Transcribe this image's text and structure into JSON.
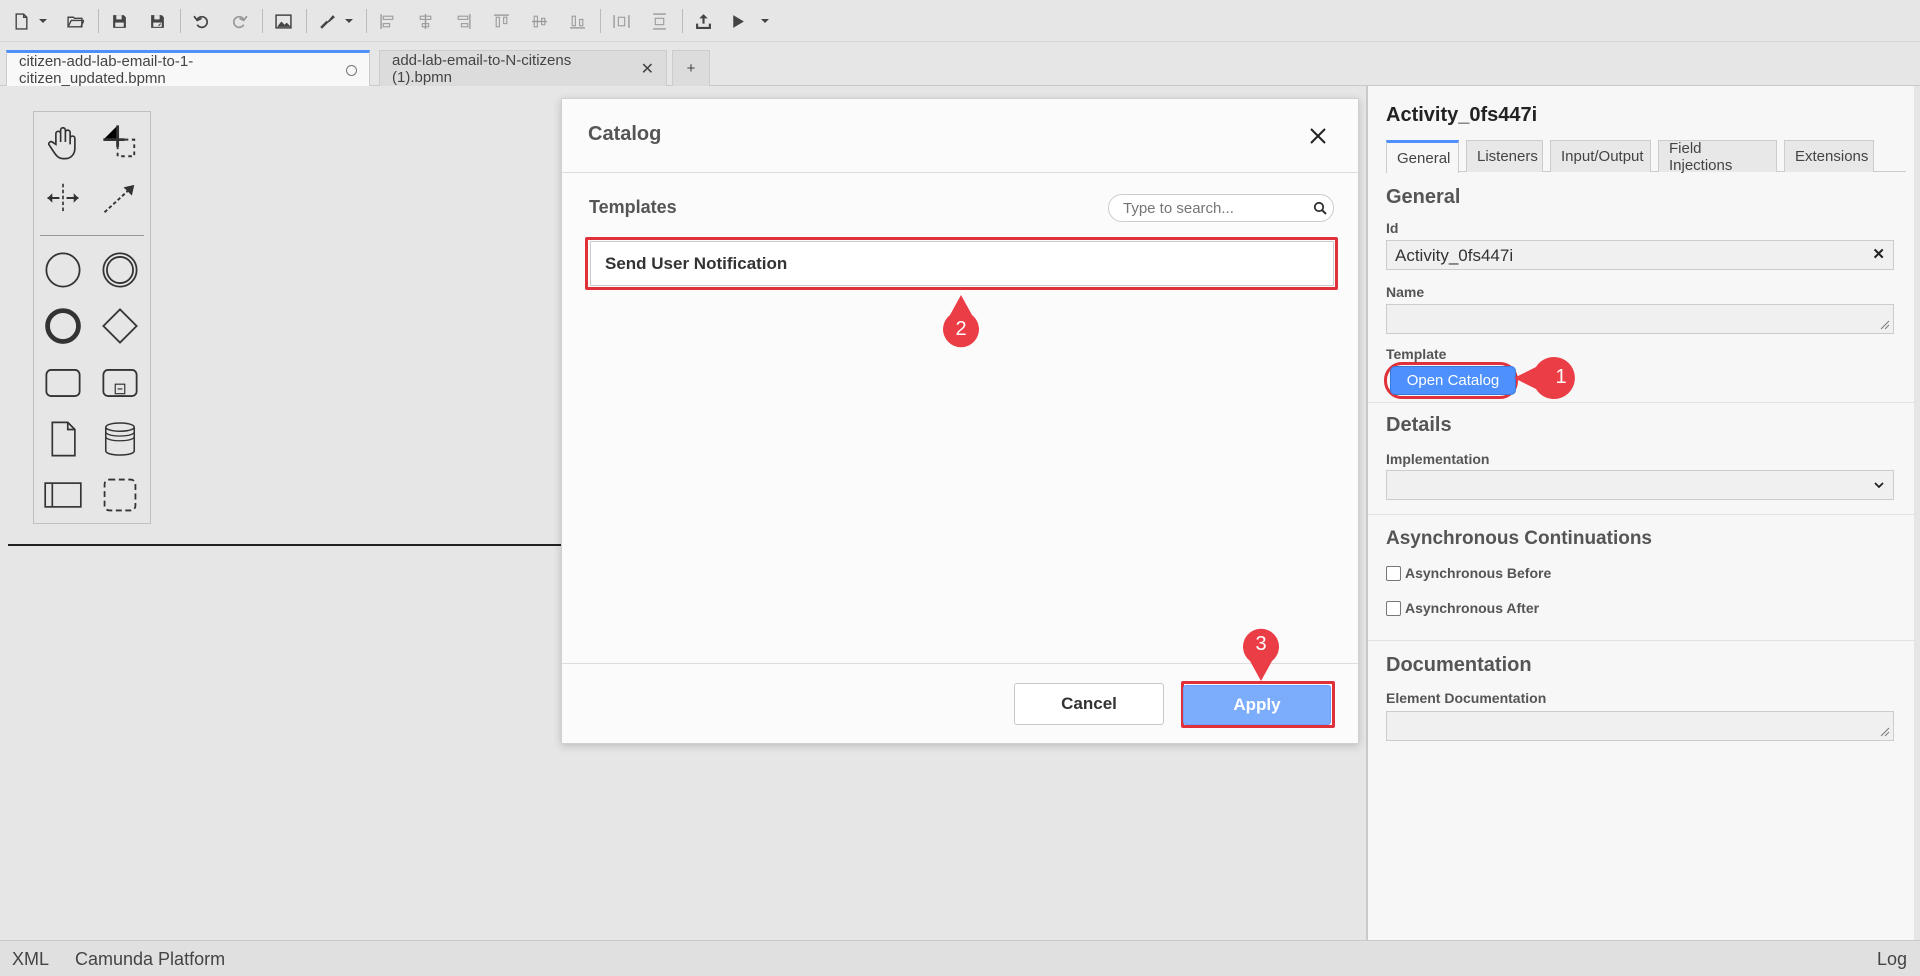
{
  "toolbar": {
    "buttons": [
      "new-file-icon",
      "open-folder-icon",
      "save-icon",
      "save-as-icon",
      "undo-icon",
      "redo-icon",
      "export-image-icon",
      "color-picker-icon",
      "align-left-icon",
      "align-center-icon",
      "align-right-icon",
      "align-top-icon",
      "align-middle-icon",
      "align-bottom-icon",
      "distribute-horizontal-icon",
      "distribute-vertical-icon",
      "deploy-icon",
      "start-instance-icon"
    ]
  },
  "tabs": [
    {
      "label": "citizen-add-lab-email-to-1-citizen_updated.bpmn",
      "active": true
    },
    {
      "label": "add-lab-email-to-N-citizens (1).bpmn",
      "active": false
    },
    {
      "label": "+"
    }
  ],
  "palette": {
    "tools": [
      "hand-tool-icon",
      "lasso-tool-icon",
      "space-tool-icon",
      "connect-tool-icon",
      "start-event-icon",
      "intermediate-event-icon",
      "end-event-icon",
      "gateway-icon",
      "task-icon",
      "subprocess-icon",
      "data-object-icon",
      "data-store-icon",
      "pool-icon",
      "group-icon"
    ]
  },
  "properties": {
    "title": "Activity_0fs447i",
    "tabs": [
      "General",
      "Listeners",
      "Input/Output",
      "Field Injections",
      "Extensions"
    ],
    "general": {
      "section_title": "General",
      "id_label": "Id",
      "id_value": "Activity_0fs447i",
      "name_label": "Name",
      "name_value": "",
      "template_label": "Template",
      "open_catalog_label": "Open Catalog"
    },
    "details": {
      "section_title": "Details",
      "implementation_label": "Implementation",
      "implementation_value": ""
    },
    "async": {
      "section_title": "Asynchronous Continuations",
      "before_label": "Asynchronous Before",
      "after_label": "Asynchronous After",
      "before_checked": false,
      "after_checked": false
    },
    "documentation": {
      "section_title": "Documentation",
      "element_doc_label": "Element Documentation",
      "element_doc_value": ""
    }
  },
  "modal": {
    "title": "Catalog",
    "templates_label": "Templates",
    "search_placeholder": "Type to search...",
    "templates": [
      "Send User Notification"
    ],
    "cancel_label": "Cancel",
    "apply_label": "Apply"
  },
  "markers": [
    "1",
    "2",
    "3"
  ],
  "statusbar": {
    "xml": "XML",
    "platform": "Camunda Platform",
    "log": "Log"
  },
  "colors": {
    "accent": "#4d90fe",
    "apply_button": "#7cacfc",
    "callout_red": "#e0303a"
  }
}
